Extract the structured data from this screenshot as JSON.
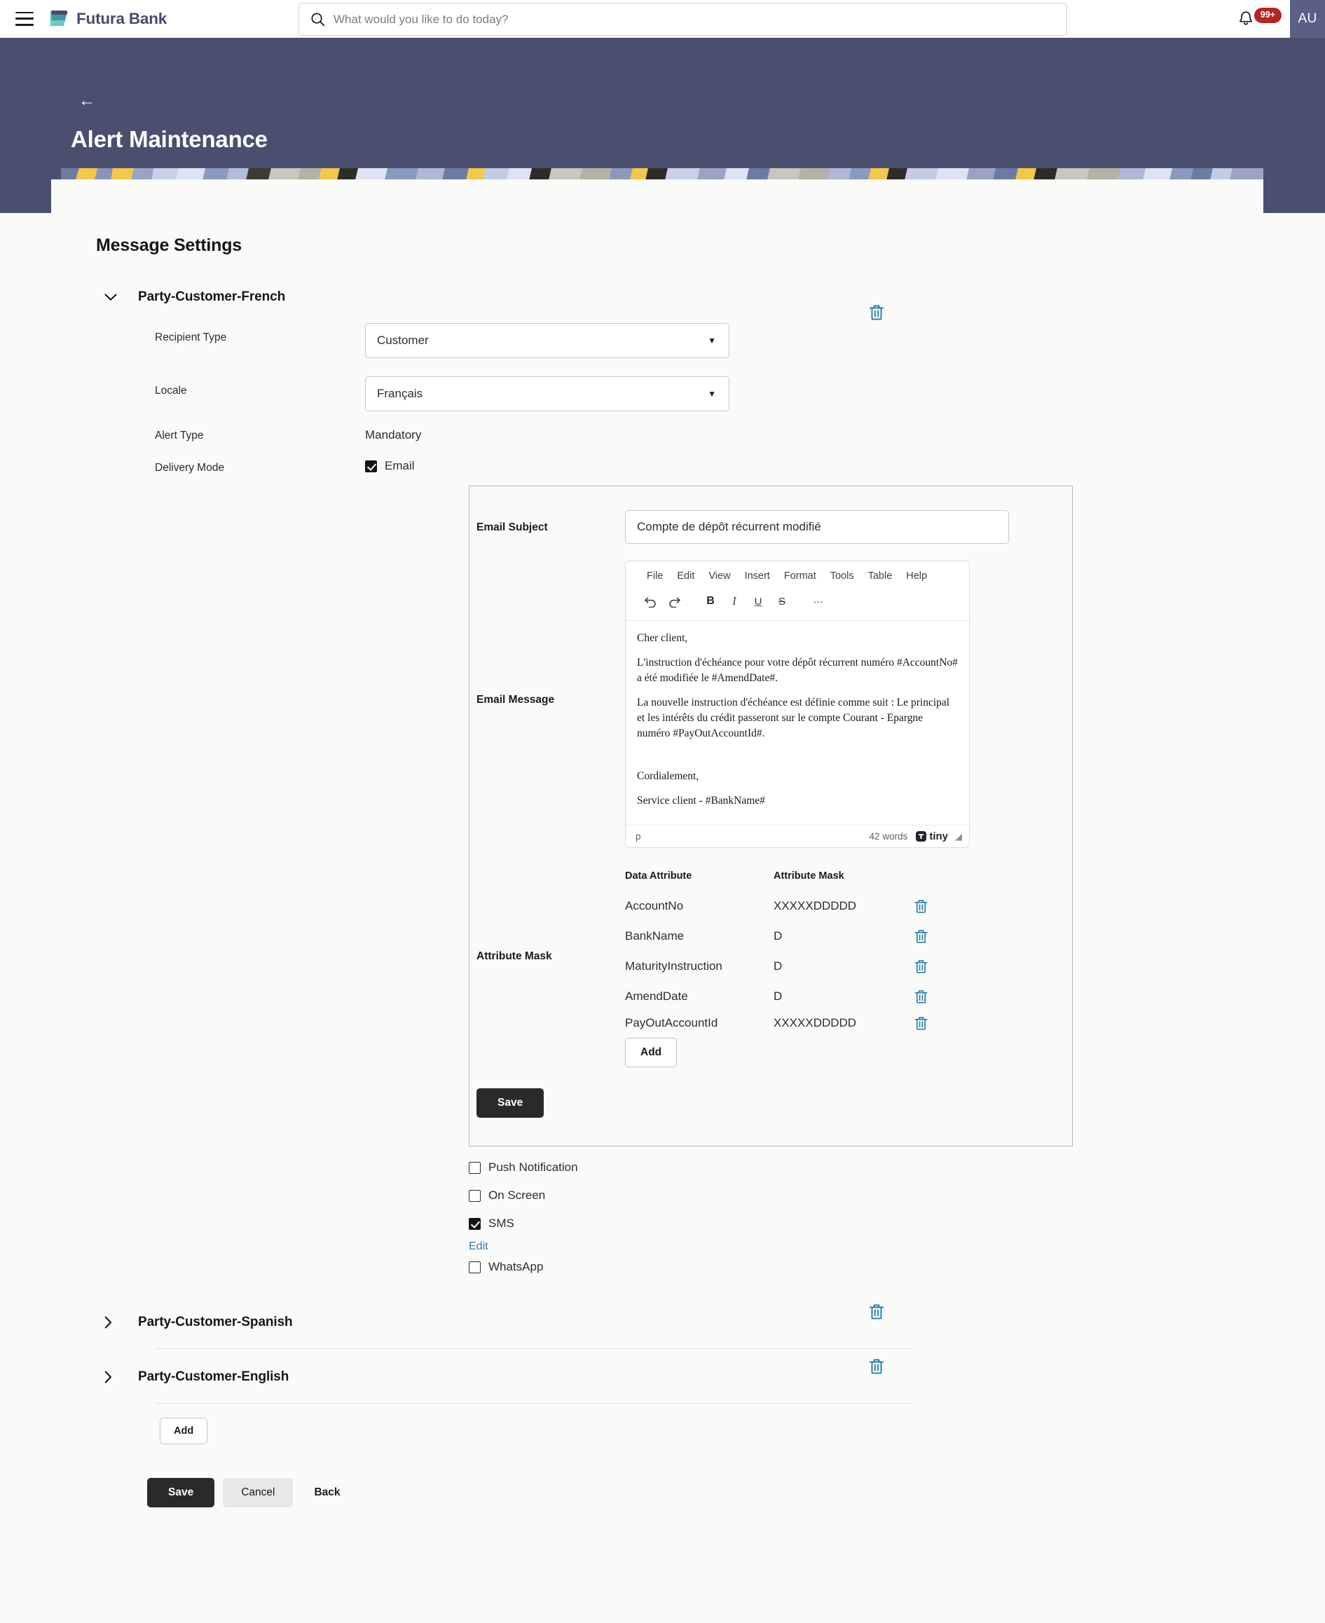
{
  "topnav": {
    "menu_icon": "hamburger-menu-icon",
    "brand": "Futura Bank",
    "search_placeholder": "What would you like to do today?",
    "search_value": "",
    "search_icon": "search-icon",
    "bell_icon": "notification-bell-icon",
    "notification_count": "99+",
    "avatar_initials": "AU"
  },
  "hero": {
    "back_icon": "arrow-left-icon",
    "title": "Alert Maintenance"
  },
  "page": {
    "section_title": "Message Settings"
  },
  "locale_group": {
    "title": "Party-Customer-French",
    "chevron_icon": "chevron-down-icon",
    "delete_icon": "trash-icon",
    "fields": {
      "recipient_type_label": "Recipient Type",
      "recipient_type_value": "Customer",
      "locale_label": "Locale",
      "locale_value": "Français",
      "alert_type_label": "Alert Type",
      "alert_type_value": "Mandatory",
      "delivery_mode_label": "Delivery Mode"
    },
    "delivery_modes": [
      {
        "label": "Email",
        "checked": true
      },
      {
        "label": "Push Notification",
        "checked": false
      },
      {
        "label": "On Screen",
        "checked": false
      },
      {
        "label": "SMS",
        "checked": true
      },
      {
        "label": "WhatsApp",
        "checked": false
      }
    ],
    "sms_edit_link": "Edit"
  },
  "email_panel": {
    "subject_label": "Email Subject",
    "subject_value": "Compte de dépôt récurrent modifié",
    "message_label": "Email Message",
    "editor": {
      "menubar": [
        "File",
        "Edit",
        "View",
        "Insert",
        "Format",
        "Tools",
        "Table",
        "Help"
      ],
      "toolbar": [
        {
          "name": "undo-icon",
          "glyph": "↶"
        },
        {
          "name": "redo-icon",
          "glyph": "↷"
        },
        {
          "name": "bold-icon",
          "glyph": "B"
        },
        {
          "name": "italic-icon",
          "glyph": "I"
        },
        {
          "name": "underline-icon",
          "glyph": "U"
        },
        {
          "name": "strikethrough-icon",
          "glyph": "S"
        },
        {
          "name": "more-options-icon",
          "glyph": "…"
        }
      ],
      "body": [
        "Cher client,",
        "L'instruction d'échéance pour votre dépôt récurrent numéro #AccountNo# a été modifiée le #AmendDate#.",
        "La nouvelle instruction d'échéance est définie comme suit : Le principal et les intérêts du crédit passeront sur le compte Courant - Epargne numéro #PayOutAccountId#.",
        "Cordialement,",
        "Service client - #BankName#"
      ],
      "status_path": "p",
      "word_count": "42 words",
      "brand": "tiny"
    },
    "attribute_mask_label": "Attribute Mask",
    "table": {
      "headers": [
        "Data Attribute",
        "Attribute Mask"
      ],
      "rows": [
        {
          "attribute": "AccountNo",
          "mask": "XXXXXDDDDD",
          "delete_icon": "trash-icon"
        },
        {
          "attribute": "BankName",
          "mask": "D",
          "delete_icon": "trash-icon"
        },
        {
          "attribute": "MaturityInstruction",
          "mask": "D",
          "delete_icon": "trash-icon"
        },
        {
          "attribute": "AmendDate",
          "mask": "D",
          "delete_icon": "trash-icon"
        },
        {
          "attribute": "PayOutAccountId",
          "mask": "XXXXXDDDDD",
          "delete_icon": "trash-icon"
        }
      ]
    },
    "add_button": "Add",
    "save_button": "Save"
  },
  "other_locales": [
    {
      "title": "Party-Customer-Spanish",
      "chevron_icon": "chevron-right-icon",
      "delete_icon": "trash-icon"
    },
    {
      "title": "Party-Customer-English",
      "chevron_icon": "chevron-right-icon",
      "delete_icon": "trash-icon"
    }
  ],
  "add_locale_button": "Add",
  "footer": {
    "save": "Save",
    "cancel": "Cancel",
    "back": "Back"
  },
  "colors": {
    "hero_bg": "#4a4f6f",
    "page_bg": "#fafaf8",
    "accent_link": "#2d7fa8",
    "trash_icon": "#1778a8",
    "badge_red": "#b4271f",
    "avatar_bg": "#5a6085",
    "primary_button": "#2b2a28"
  }
}
